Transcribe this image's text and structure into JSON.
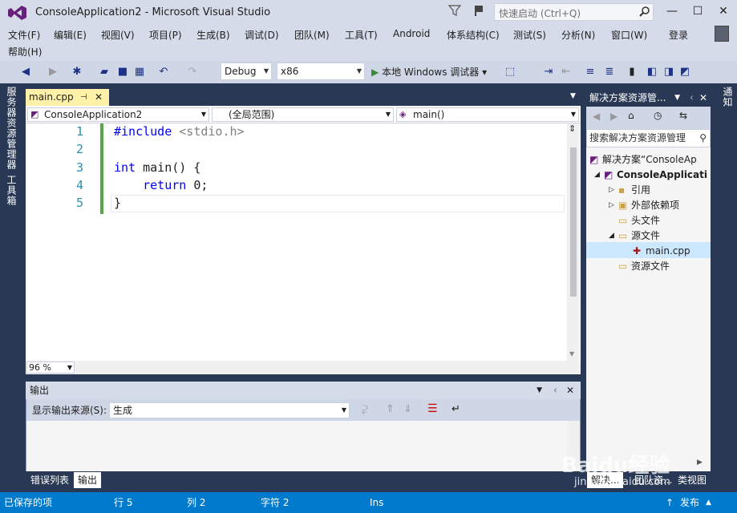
{
  "window": {
    "title": "ConsoleApplication2 - Microsoft Visual Studio",
    "quick_launch_placeholder": "快速启动 (Ctrl+Q)"
  },
  "menu": [
    "文件(F)",
    "编辑(E)",
    "视图(V)",
    "项目(P)",
    "生成(B)",
    "调试(D)",
    "团队(M)",
    "工具(T)",
    "Android",
    "体系结构(C)",
    "测试(S)",
    "分析(N)",
    "窗口(W)",
    "登录",
    "帮助(H)"
  ],
  "toolbar": {
    "config": "Debug",
    "platform": "x86",
    "debugger": "本地 Windows 调试器"
  },
  "side_tabs": {
    "left": [
      "服务器资源管理器",
      "工具箱"
    ],
    "right": "通知"
  },
  "editor": {
    "tab": "main.cpp",
    "nav_project": "ConsoleApplication2",
    "nav_scope": "(全局范围)",
    "nav_member": "main()",
    "lines": [
      {
        "n": "1",
        "parts": [
          {
            "t": "#include ",
            "c": "kw"
          },
          {
            "t": "<stdio.h>",
            "c": "inc"
          }
        ]
      },
      {
        "n": "2",
        "parts": []
      },
      {
        "n": "3",
        "parts": [
          {
            "t": "int",
            "c": "kw"
          },
          {
            "t": " main() {",
            "c": ""
          }
        ]
      },
      {
        "n": "4",
        "parts": [
          {
            "t": "    ",
            "c": ""
          },
          {
            "t": "return",
            "c": "kw"
          },
          {
            "t": " 0;",
            "c": ""
          }
        ]
      },
      {
        "n": "5",
        "parts": [
          {
            "t": "}",
            "c": ""
          }
        ]
      }
    ],
    "zoom": "96 %"
  },
  "output": {
    "title": "输出",
    "source_label": "显示输出来源(S):",
    "source_value": "生成",
    "tabs": [
      "错误列表",
      "输出"
    ]
  },
  "solution_explorer": {
    "title": "解决方案资源管...",
    "search_placeholder": "搜索解决方案资源管理",
    "tree": [
      {
        "label": "解决方案“ConsoleAp",
        "indent": 0
      },
      {
        "label": "ConsoleApplicati",
        "indent": 1,
        "bold": true
      },
      {
        "label": "引用",
        "indent": 2
      },
      {
        "label": "外部依赖项",
        "indent": 2
      },
      {
        "label": "头文件",
        "indent": 2
      },
      {
        "label": "源文件",
        "indent": 2
      },
      {
        "label": "main.cpp",
        "indent": 3
      },
      {
        "label": "资源文件",
        "indent": 2
      }
    ],
    "bottom_tabs": [
      "解决...",
      "团队资...",
      "类视图"
    ]
  },
  "status": {
    "saved": "已保存的项",
    "line": "行 5",
    "col": "列 2",
    "char": "字符 2",
    "mode": "Ins",
    "publish": "发布"
  },
  "watermark": {
    "text": "Baidu经验",
    "url": "jingyan.baidu.com"
  }
}
